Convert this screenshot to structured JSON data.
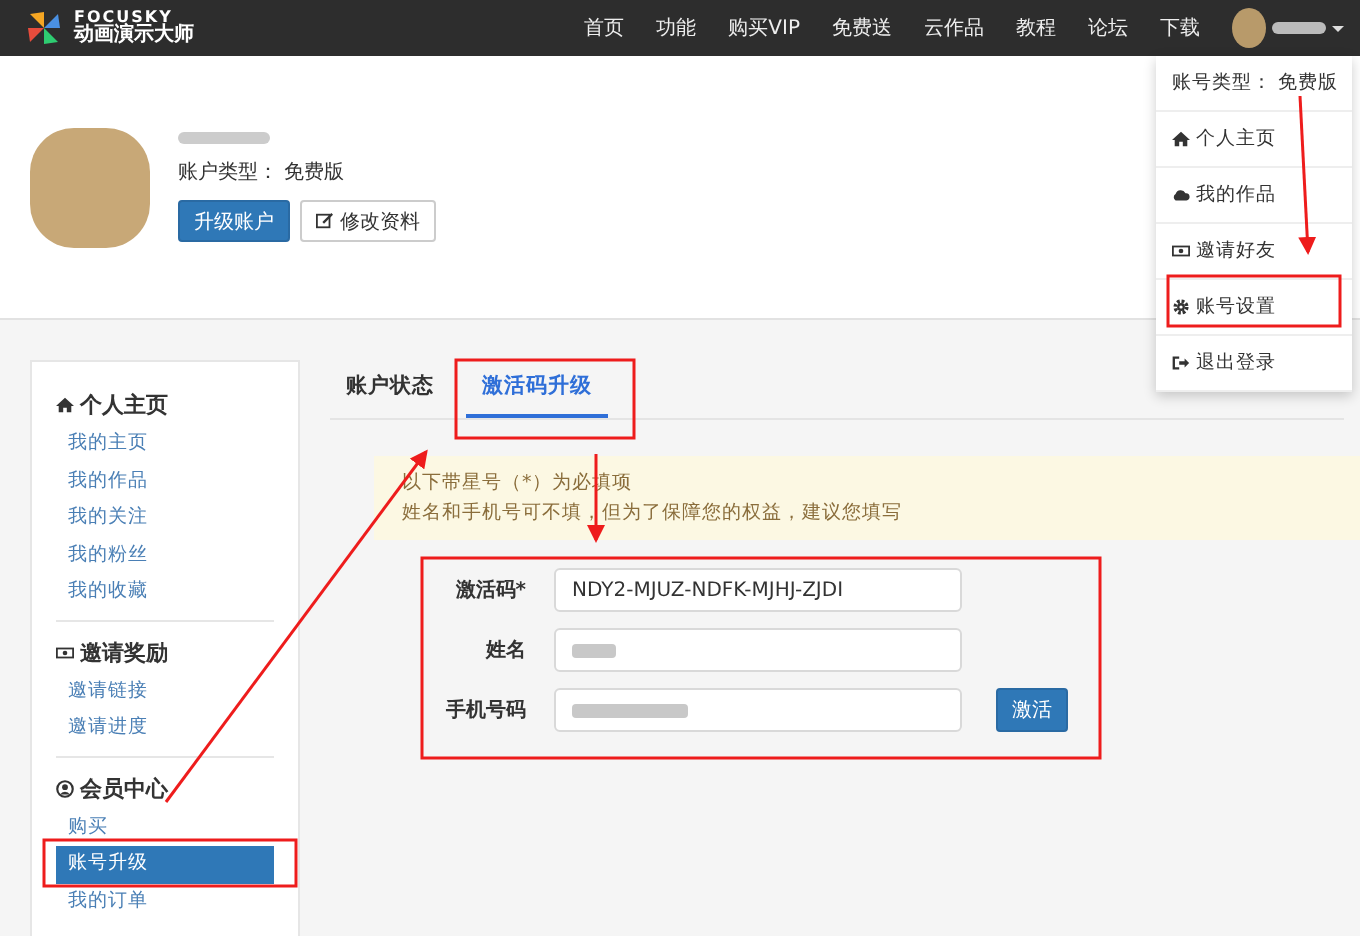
{
  "navbar": {
    "brand": "FOCUSKY",
    "subtitle": "动画演示大师",
    "items": [
      "首页",
      "功能",
      "购买VIP",
      "免费送",
      "云作品",
      "教程",
      "论坛",
      "下载"
    ]
  },
  "user_menu": {
    "expanded": true,
    "account_type": "账号类型： 免费版",
    "items": [
      {
        "label": "个人主页",
        "kind": "home"
      },
      {
        "label": "我的作品",
        "kind": "cloud"
      },
      {
        "label": "邀请好友",
        "kind": "money"
      },
      {
        "label": "账号设置",
        "kind": "gear"
      },
      {
        "label": "退出登录",
        "kind": "logout"
      }
    ]
  },
  "profile": {
    "account_type": "账户类型： 免费版",
    "buttons": [
      {
        "label": "升级账户",
        "kind": "primary"
      },
      {
        "label": "修改资料",
        "kind": "edit"
      }
    ]
  },
  "sidebar": {
    "sections": [
      {
        "title": "个人主页",
        "kind": "home",
        "items": [
          {
            "label": "我的主页",
            "selected": false
          },
          {
            "label": "我的作品",
            "selected": false
          },
          {
            "label": "我的关注",
            "selected": false
          },
          {
            "label": "我的粉丝",
            "selected": false
          },
          {
            "label": "我的收藏",
            "selected": false
          }
        ]
      },
      {
        "title": "邀请奖励",
        "kind": "money",
        "items": [
          {
            "label": "邀请链接",
            "selected": false
          },
          {
            "label": "邀请进度",
            "selected": false
          }
        ]
      },
      {
        "title": "会员中心",
        "kind": "user",
        "items": [
          {
            "label": "购买",
            "selected": false
          },
          {
            "label": "账号升级",
            "selected": true
          },
          {
            "label": "我的订单",
            "selected": false
          }
        ]
      }
    ]
  },
  "tabs": [
    {
      "label": "账户状态",
      "selected": false
    },
    {
      "label": "激活码升级",
      "selected": true
    }
  ],
  "notice": [
    "以下带星号（*）为必填项",
    "姓名和手机号可不填，但为了保障您的权益，建议您填写"
  ],
  "form": {
    "fields": [
      {
        "label": "激活码*",
        "value": "NDY2-MJUZ-NDFK-MJHJ-ZJDI",
        "blurred": false
      },
      {
        "label": "姓名",
        "blurred": true
      },
      {
        "label": "手机号码",
        "blurred": true
      }
    ],
    "submit": "激活"
  }
}
